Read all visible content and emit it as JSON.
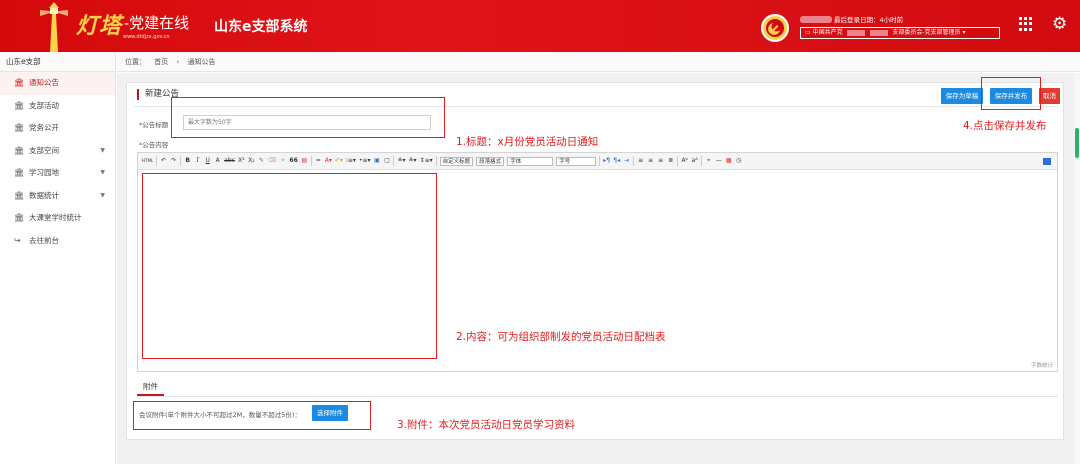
{
  "header": {
    "logo_text": "灯塔",
    "logo_sub": "-党建在线",
    "logo_url": "www.dtdjzx.gov.cn",
    "system_title": "山东e支部系统",
    "last_login": "最后登录日期：4小时前",
    "org_prefix": "中国共产党",
    "org_suffix": "支部委员会-党支部管理员",
    "grid_icon": "apps-grid-icon",
    "settings_icon": "gear-icon"
  },
  "sidebar": {
    "heading": "山东e支部",
    "items": [
      {
        "label": "通知公告",
        "icon": "building-icon",
        "active": true,
        "caret": false
      },
      {
        "label": "支部活动",
        "icon": "building-icon",
        "active": false,
        "caret": false
      },
      {
        "label": "党务公开",
        "icon": "building-icon",
        "active": false,
        "caret": false
      },
      {
        "label": "支部空间",
        "icon": "building-icon",
        "active": false,
        "caret": true
      },
      {
        "label": "学习园地",
        "icon": "building-icon",
        "active": false,
        "caret": true
      },
      {
        "label": "数据统计",
        "icon": "building-icon",
        "active": false,
        "caret": true
      },
      {
        "label": "大课堂学时统计",
        "icon": "building-icon",
        "active": false,
        "caret": false
      },
      {
        "label": "去往前台",
        "icon": "arrow-right-icon",
        "active": false,
        "caret": false
      }
    ]
  },
  "breadcrumb": {
    "prefix": "位置：",
    "home": "首页",
    "sep": "›",
    "current": "通知公告"
  },
  "form": {
    "panel_title": "新建公告",
    "save_draft": "保存为草稿",
    "save_publish": "保存并发布",
    "cancel": "取消",
    "title_label": "*公告标题",
    "title_placeholder": "最大字数为50字",
    "content_label": "*公告内容",
    "word_count": "字数统计",
    "toolbar_selects": [
      "自定义标题",
      "段落格式",
      "字体",
      "字号"
    ],
    "attach_tab": "附件",
    "attach_text": "会议附件(单个附件大小不可超过2M，数量不超过5份)：",
    "attach_button": "选择附件"
  },
  "annotations": {
    "a1": "1.标题：x月份党员活动日通知",
    "a2": "2.内容：可为组织部制发的党员活动日配档表",
    "a3": "3.附件：本次党员活动日党员学习资料",
    "a4": "4.点击保存并发布"
  },
  "colors": {
    "header_red": "#d4090a",
    "accent_blue": "#1c8ae0",
    "annotation_red": "#e31b1b",
    "scroll_green": "#2bb16b"
  }
}
